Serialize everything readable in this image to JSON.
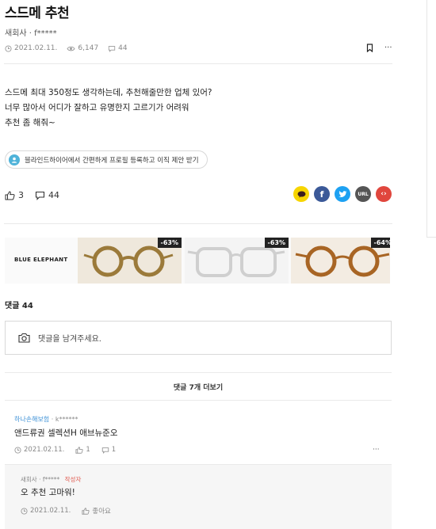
{
  "post": {
    "title": "스드메 추천",
    "author": "새회사 · f*****",
    "date": "2021.02.11.",
    "views": "6,147",
    "comments": "44",
    "body_lines": [
      "스드메 최대 350정도 생각하는데, 추천해줄만한 업체 있어?",
      "너무 많아서 어디가 잘하고 유명한지 고르기가 어려워",
      "추천 좀 해줘~"
    ]
  },
  "promo": {
    "label": "블라인드하이어에서 간편하게 프로필 등록하고 이직 제안 받기"
  },
  "reactions": {
    "likes": "3",
    "comments": "44"
  },
  "share": [
    {
      "name": "kakao",
      "label": "",
      "color": "#f7d500"
    },
    {
      "name": "facebook",
      "label": "f",
      "color": "#3b5998"
    },
    {
      "name": "twitter",
      "label": "",
      "color": "#1da1f2"
    },
    {
      "name": "url",
      "label": "URL",
      "color": "#555555"
    },
    {
      "name": "embed",
      "label": "‹›",
      "color": "#e0463d"
    }
  ],
  "ad": {
    "brand": "BLUE ELEPHANT",
    "products": [
      {
        "discount": "-63%",
        "frame_color": "#9b7a3a"
      },
      {
        "discount": "-63%",
        "frame_color": "#d4d4d4"
      },
      {
        "discount": "-64%",
        "frame_color": "#a86524"
      }
    ]
  },
  "comments_section": {
    "title": "댓글 44",
    "placeholder": "댓글을 남겨주세요.",
    "more_label": "댓글 7개 더보기",
    "items": [
      {
        "company": "하나손해보험",
        "user": "k******",
        "text": "앤드류권 셀렉션H 애브뉴준오",
        "date": "2021.02.11.",
        "likes": "1",
        "replies": "1"
      },
      {
        "company": "새회사",
        "user": "f*****",
        "author_badge": "작성자",
        "text": "오 추천 고마워!",
        "date": "2021.02.11.",
        "like_label": "좋아요"
      }
    ]
  }
}
